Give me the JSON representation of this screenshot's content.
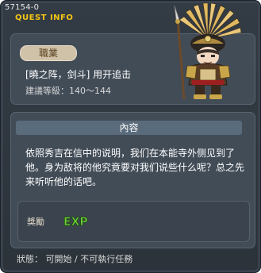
{
  "window": {
    "quest_id": "57154-0",
    "header_label": "QUEST INFO"
  },
  "quest": {
    "job_label": "職業",
    "title": "[曉之阵，剑斗] 用开追击",
    "level": "建議等級：140～144"
  },
  "content": {
    "section_title": "內容",
    "description": "依照秀吉在信中的说明，我们在本能寺外侧见到了他。身为敌将的他究竟要对我们说些什么呢？总之先来听听他的话吧。"
  },
  "reward": {
    "label": "獎勵",
    "exp_text": "EXP"
  },
  "status": {
    "label": "狀態：",
    "value": "可開始 / 不可執行任務"
  },
  "colors": {
    "accent_gold": "#f3c614",
    "panel_bg": "#424c57",
    "exp_green": "#6fd13a"
  }
}
